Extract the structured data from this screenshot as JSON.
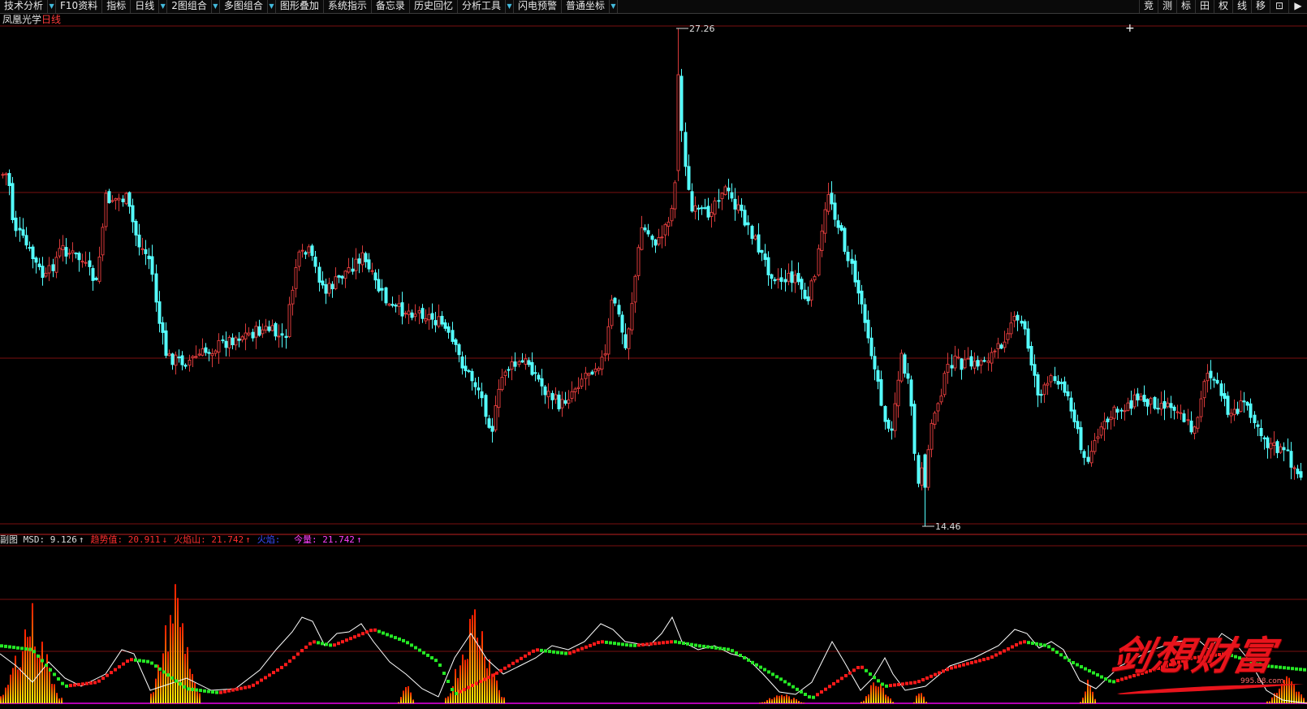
{
  "toolbar": {
    "left": [
      {
        "label": "技术分析",
        "dropdown": true
      },
      {
        "label": "F10资料",
        "dropdown": false
      },
      {
        "label": "指标",
        "dropdown": false
      },
      {
        "label": "日线",
        "dropdown": true
      },
      {
        "label": "2图组合",
        "dropdown": true
      },
      {
        "label": "多图组合",
        "dropdown": true
      },
      {
        "label": "图形叠加",
        "dropdown": false
      },
      {
        "label": "系统指示",
        "dropdown": false
      },
      {
        "label": "备忘录",
        "dropdown": false
      },
      {
        "label": "历史回忆",
        "dropdown": false
      },
      {
        "label": "分析工具",
        "dropdown": true
      },
      {
        "label": "闪电预警",
        "dropdown": false
      },
      {
        "label": "普通坐标",
        "dropdown": true
      }
    ],
    "right": [
      "竞",
      "测",
      "标",
      "田",
      "权",
      "线",
      "移",
      "⊡",
      "▶"
    ]
  },
  "stock": {
    "name": "凤凰光学",
    "period": "日线"
  },
  "price_panel": {
    "high_label": "27.26",
    "low_label": "14.46"
  },
  "indicator": {
    "prefix": "副图",
    "items": [
      {
        "label": "MSD: 9.126",
        "arrow": "↑",
        "color": "#dddddd"
      },
      {
        "label": "趋势值: 20.911",
        "arrow": "↓",
        "color": "#ff2e2e"
      },
      {
        "label": "火焰山: 21.742",
        "arrow": "↑",
        "color": "#ff2e2e"
      },
      {
        "label": "火焰: ",
        "arrow": "",
        "color": "#3a4cff"
      },
      {
        "label": "今量: 21.742",
        "arrow": "↑",
        "color": "#ff40ff"
      }
    ]
  },
  "watermark": {
    "text": "剑想财富",
    "sub": "995.88.com"
  },
  "colors": {
    "up": "#d83a3a",
    "down": "#54ffff",
    "grid": "#7a1010",
    "msd": "#ffffff",
    "trend_up": "#ff1a1a",
    "trend_down": "#25e825",
    "flame_top": "#ff1a00",
    "flame_bottom": "#ffe800"
  }
}
